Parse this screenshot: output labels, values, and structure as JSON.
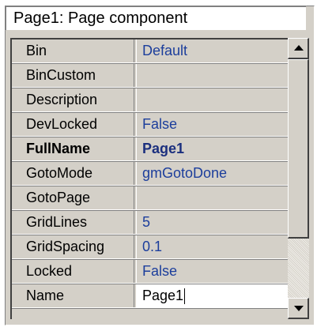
{
  "header": {
    "title": "Page1: Page component"
  },
  "properties": [
    {
      "name": "Bin",
      "value": "Default"
    },
    {
      "name": "BinCustom",
      "value": ""
    },
    {
      "name": "Description",
      "value": ""
    },
    {
      "name": "DevLocked",
      "value": "False"
    },
    {
      "name": "FullName",
      "value": "Page1"
    },
    {
      "name": "GotoMode",
      "value": "gmGotoDone"
    },
    {
      "name": "GotoPage",
      "value": ""
    },
    {
      "name": "GridLines",
      "value": "5"
    },
    {
      "name": "GridSpacing",
      "value": "0.1"
    },
    {
      "name": "Locked",
      "value": "False"
    },
    {
      "name": "Name",
      "value": "Page1"
    }
  ],
  "scrollbar": {
    "up_icon": "arrow-up-icon",
    "down_icon": "arrow-down-icon"
  }
}
